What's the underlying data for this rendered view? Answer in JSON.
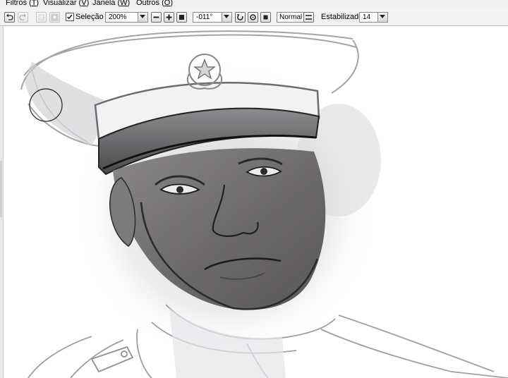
{
  "menu": {
    "items": [
      {
        "label": "Filtros",
        "key": "T"
      },
      {
        "label": "Visualizar",
        "key": "V"
      },
      {
        "label": "Janela",
        "key": "W"
      },
      {
        "label": "Outros",
        "key": "O"
      }
    ]
  },
  "toolbar": {
    "selection_label": "Seleção",
    "selection_checked": true,
    "zoom_value": "200%",
    "rotation_value": "-011°",
    "blend_mode": "Normal",
    "stabilizer_label": "Estabilizador",
    "stabilizer_value": "14"
  },
  "canvas": {
    "background": "#ffffff",
    "skin_color": "#6f6c6e",
    "line_color": "#2a2a2a",
    "sketch_color": "#a9a9b0"
  },
  "icons": [
    "undo-icon",
    "redo-icon",
    "clear-selection-icon",
    "invert-selection-icon",
    "zoom-out-icon",
    "zoom-in-icon",
    "zoom-fit-icon",
    "rotate-left-icon",
    "rotate-reset-icon",
    "rotate-right-icon",
    "flip-icon",
    "brush-cursor-icon"
  ]
}
